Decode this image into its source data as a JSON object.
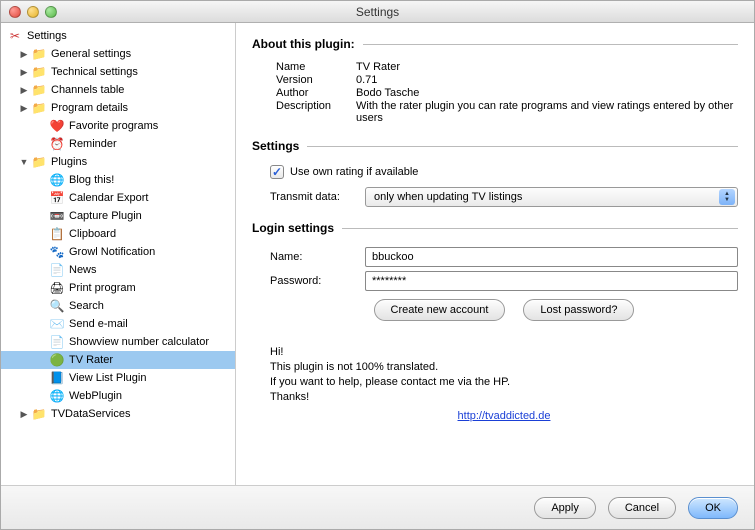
{
  "window": {
    "title": "Settings"
  },
  "sidebar": {
    "root": "Settings",
    "items": [
      {
        "label": "General settings",
        "icon": "📁",
        "expandable": true,
        "open": false,
        "indent": 1
      },
      {
        "label": "Technical settings",
        "icon": "📁",
        "expandable": true,
        "open": false,
        "indent": 1
      },
      {
        "label": "Channels table",
        "icon": "📁",
        "expandable": true,
        "open": false,
        "indent": 1
      },
      {
        "label": "Program details",
        "icon": "📁",
        "expandable": true,
        "open": false,
        "indent": 1
      },
      {
        "label": "Favorite programs",
        "icon": "❤️",
        "expandable": false,
        "indent": 2
      },
      {
        "label": "Reminder",
        "icon": "⏰",
        "expandable": false,
        "indent": 2
      },
      {
        "label": "Plugins",
        "icon": "📁",
        "expandable": true,
        "open": true,
        "indent": 1
      },
      {
        "label": "Blog this!",
        "icon": "🌐",
        "expandable": false,
        "indent": 2
      },
      {
        "label": "Calendar Export",
        "icon": "📅",
        "expandable": false,
        "indent": 2
      },
      {
        "label": "Capture Plugin",
        "icon": "📼",
        "expandable": false,
        "indent": 2
      },
      {
        "label": "Clipboard",
        "icon": "📋",
        "expandable": false,
        "indent": 2
      },
      {
        "label": "Growl Notification",
        "icon": "🐾",
        "expandable": false,
        "indent": 2
      },
      {
        "label": "News",
        "icon": "📄",
        "expandable": false,
        "indent": 2
      },
      {
        "label": "Print program",
        "icon": "🖨",
        "expandable": false,
        "indent": 2
      },
      {
        "label": "Search",
        "icon": "🔍",
        "expandable": false,
        "indent": 2
      },
      {
        "label": "Send e-mail",
        "icon": "✉️",
        "expandable": false,
        "indent": 2
      },
      {
        "label": "Showview number calculator",
        "icon": "📄",
        "expandable": false,
        "indent": 2
      },
      {
        "label": "TV Rater",
        "icon": "🟢",
        "expandable": false,
        "indent": 2,
        "selected": true
      },
      {
        "label": "View List Plugin",
        "icon": "📘",
        "expandable": false,
        "indent": 2
      },
      {
        "label": "WebPlugin",
        "icon": "🌐",
        "expandable": false,
        "indent": 2
      },
      {
        "label": "TVDataServices",
        "icon": "📁",
        "expandable": true,
        "open": false,
        "indent": 1
      }
    ]
  },
  "about": {
    "title": "About this plugin:",
    "rows": [
      {
        "key": "Name",
        "val": "TV Rater"
      },
      {
        "key": "Version",
        "val": "0.71"
      },
      {
        "key": "Author",
        "val": "Bodo Tasche"
      },
      {
        "key": "Description",
        "val": "With the rater plugin you can rate programs and view ratings entered by other users"
      }
    ]
  },
  "settings": {
    "title": "Settings",
    "useOwn": "Use own rating if available",
    "transmitLabel": "Transmit data:",
    "transmitValue": "only when updating TV listings"
  },
  "login": {
    "title": "Login settings",
    "nameLabel": "Name:",
    "nameValue": "bbuckoo",
    "passLabel": "Password:",
    "passValue": "********",
    "createBtn": "Create new account",
    "lostBtn": "Lost password?"
  },
  "note": {
    "l1": "Hi!",
    "l2": "This plugin is not 100% translated.",
    "l3": "If you want to help, please contact me via the HP.",
    "l4": "Thanks!",
    "link": "http://tvaddicted.de"
  },
  "footer": {
    "apply": "Apply",
    "cancel": "Cancel",
    "ok": "OK"
  }
}
